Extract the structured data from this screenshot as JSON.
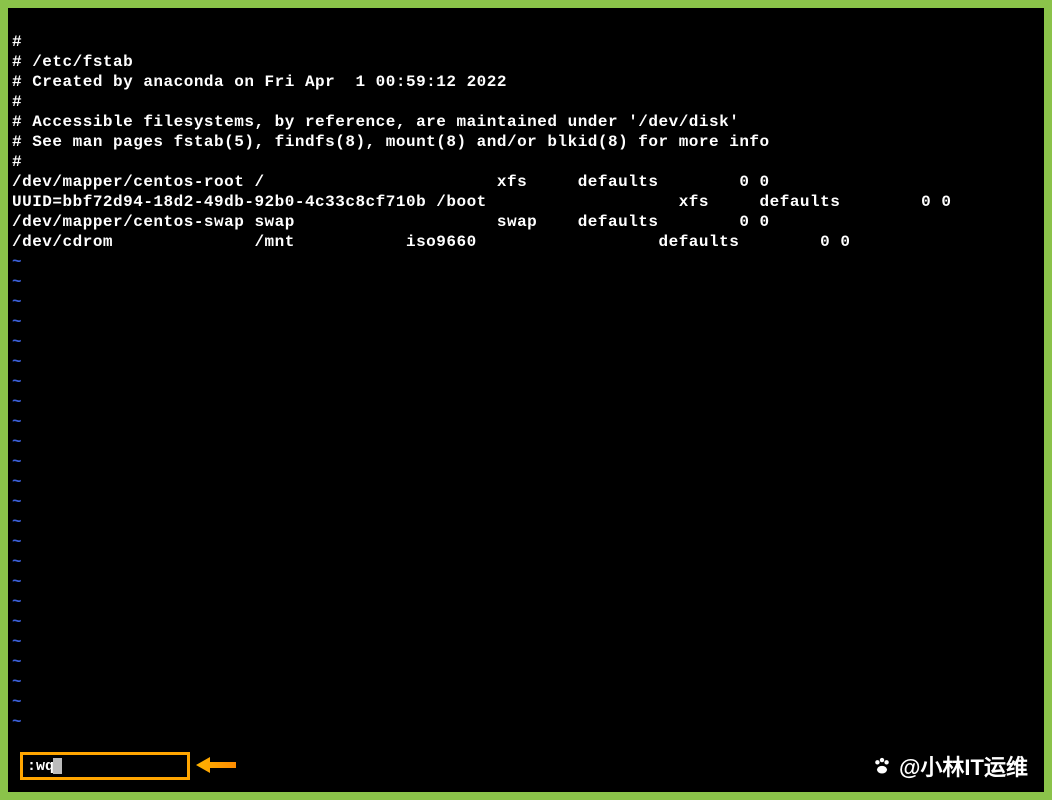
{
  "terminal": {
    "content_lines": [
      {
        "color": "white",
        "text": "#"
      },
      {
        "color": "white",
        "text": "# /etc/fstab"
      },
      {
        "color": "white",
        "text": "# Created by anaconda on Fri Apr  1 00:59:12 2022"
      },
      {
        "color": "white",
        "text": "#"
      },
      {
        "color": "white",
        "text": "# Accessible filesystems, by reference, are maintained under '/dev/disk'"
      },
      {
        "color": "white",
        "text": "# See man pages fstab(5), findfs(8), mount(8) and/or blkid(8) for more info"
      },
      {
        "color": "white",
        "text": "#"
      },
      {
        "color": "white",
        "text": "/dev/mapper/centos-root /                       xfs     defaults        0 0"
      },
      {
        "color": "white",
        "text": "UUID=bbf72d94-18d2-49db-92b0-4c33c8cf710b /boot                   xfs     defaults        0 0"
      },
      {
        "color": "white",
        "text": "/dev/mapper/centos-swap swap                    swap    defaults        0 0"
      },
      {
        "color": "white",
        "text": "/dev/cdrom              /mnt           iso9660                  defaults        0 0"
      }
    ],
    "tilde_lines": 24,
    "tilde_char": "~",
    "command_input": ":wq"
  },
  "watermark": {
    "text": "@小林IT运维"
  }
}
